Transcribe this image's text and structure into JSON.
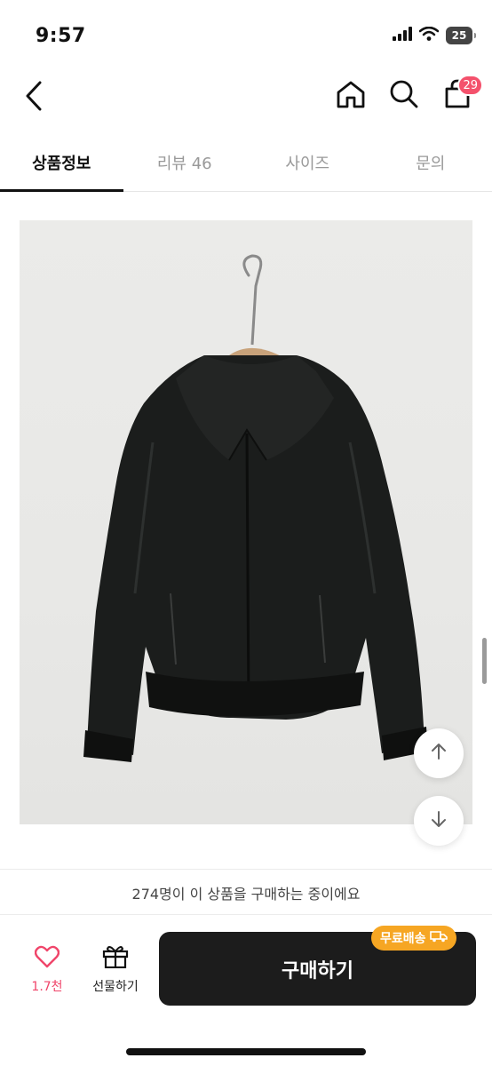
{
  "status_bar": {
    "time": "9:57",
    "battery": "25",
    "icons": [
      "signal-icon",
      "wifi-icon",
      "battery-icon"
    ]
  },
  "nav": {
    "icons": [
      "back-icon",
      "home-icon",
      "search-icon",
      "cart-icon"
    ],
    "cart_count": "29"
  },
  "tabs": [
    {
      "label": "상품정보",
      "active": true
    },
    {
      "label": "리뷰 46",
      "active": false
    },
    {
      "label": "사이즈",
      "active": false
    },
    {
      "label": "문의",
      "active": false
    }
  ],
  "product_image": {
    "alt": "black leather bomber jacket on hanger"
  },
  "scroll_buttons": [
    "arrow-up-icon",
    "arrow-down-icon"
  ],
  "purchase_info": "274명이 이 상품을 구매하는 중이에요",
  "bottom_bar": {
    "like_count": "1.7천",
    "gift_label": "선물하기",
    "buy_label": "구매하기",
    "free_shipping_label": "무료배송"
  },
  "colors": {
    "accent_pink": "#f0456a",
    "badge_pink": "#f4516c",
    "buy_button": "#1c1c1c",
    "free_shipping": "#f6a623"
  }
}
